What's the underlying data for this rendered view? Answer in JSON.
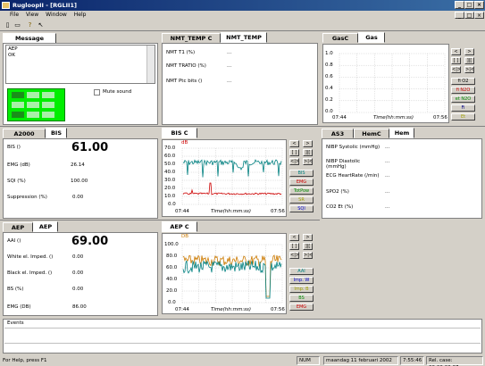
{
  "window": {
    "title": "RugloopII - [RGLII1]",
    "min": "_",
    "max": "□",
    "close": "×"
  },
  "menu": {
    "items": [
      "File",
      "View",
      "Window",
      "Help"
    ]
  },
  "toolbar": {
    "icons": [
      "new-icon",
      "open-icon",
      "help-icon",
      "context-help-icon"
    ]
  },
  "message": {
    "tab": "Message",
    "lines": [
      "AEP",
      "OK"
    ],
    "mute_label": "Mute sound"
  },
  "nmt": {
    "tabs": [
      "NMT_TEMP C",
      "NMT_TEMP"
    ],
    "rows": [
      {
        "label": "NMT T1 (%)",
        "value": "..."
      },
      {
        "label": "NMT TRATIO (%)",
        "value": "..."
      },
      {
        "label": "NMT Ptc bits ()",
        "value": "..."
      }
    ]
  },
  "gas": {
    "tabs": [
      "GasC",
      "Gas"
    ],
    "yticks": [
      "1.0",
      "0.8",
      "0.6",
      "0.4",
      "0.2",
      "0.0"
    ],
    "x_start": "07:44",
    "x_end": "07:56",
    "x_label": "Time(hh:mm:ss)",
    "buttons": [
      "fi O2",
      "fi N2O",
      "et N2O",
      "Fi",
      "Et"
    ],
    "btn_colors": [
      "#000000",
      "#cc0000",
      "#008800",
      "#000080",
      "#808000"
    ]
  },
  "bis": {
    "tabs": [
      "A2000",
      "BIS"
    ],
    "main_label": "BIS ()",
    "main_value": "61.00",
    "rows": [
      {
        "label": "EMG (dB)",
        "value": "26.14"
      },
      {
        "label": "SQI (%)",
        "value": "100.00"
      },
      {
        "label": "Suppression (%)",
        "value": "0.00"
      }
    ]
  },
  "bis_chart": {
    "tab": "BIS C",
    "unit": "dB",
    "yticks": [
      "70.0",
      "60.0",
      "50.0",
      "40.0",
      "30.0",
      "20.0",
      "10.0",
      "0.0"
    ],
    "x_start": "07:44",
    "x_end": "07:56",
    "x_label": "Time(hh:mm:ss)",
    "buttons": [
      "BIS",
      "EMG",
      "TotPow",
      "SR",
      "SQI"
    ],
    "btn_colors": [
      "#008080",
      "#cc0000",
      "#008800",
      "#808000",
      "#0000cc"
    ]
  },
  "as3": {
    "tabs": [
      "AS3",
      "HemC",
      "Hem"
    ],
    "rows": [
      {
        "label": "NIBP Systolic (mmHg)",
        "value": "..."
      },
      {
        "label": "NIBP Diastolic (mmHg)",
        "value": "..."
      },
      {
        "label": "ECG HeartRate (/min)",
        "value": "..."
      },
      {
        "label": "SPO2 (%)",
        "value": "..."
      },
      {
        "label": "CO2 Et (%)",
        "value": "..."
      }
    ]
  },
  "aep": {
    "tabs": [
      "AEP",
      "AEP"
    ],
    "main_label": "AAI ()",
    "main_value": "69.00",
    "rows": [
      {
        "label": "White el. Imped. ()",
        "value": "0.00"
      },
      {
        "label": "Black el. Imped. ()",
        "value": "0.00"
      },
      {
        "label": "BS (%)",
        "value": "0.00"
      },
      {
        "label": "EMG (DB)",
        "value": "86.00"
      }
    ]
  },
  "aep_chart": {
    "tab": "AEP C",
    "unit": "DB",
    "yticks": [
      "100.0",
      "80.0",
      "60.0",
      "40.0",
      "20.0",
      "0.0"
    ],
    "x_start": "07:44",
    "x_end": "07:56",
    "x_label": "Time(hh:mm:ss)",
    "buttons": [
      "AAI",
      "Imp. W",
      "Imp. B",
      "BS",
      "EMG"
    ],
    "btn_colors": [
      "#008080",
      "#0000cc",
      "#808000",
      "#008800",
      "#cc0000"
    ]
  },
  "events": {
    "label": "Events"
  },
  "status": {
    "help": "For Help, press F1",
    "num": "NUM",
    "date": "maandag 11 februari 2002",
    "time": "7:55:46",
    "rel": "Rel. case: 00:00:00:37"
  }
}
